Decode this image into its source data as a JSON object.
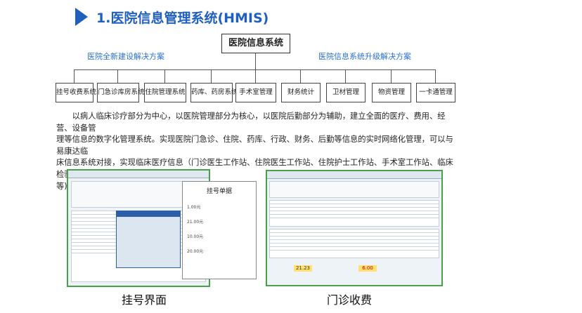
{
  "title": "1.医院信息管理系统(HMIS)",
  "root": "医院信息系统",
  "branches": {
    "left": "医院全新建设解决方案",
    "right": "医院信息系统升级解决方案"
  },
  "modules": [
    "挂号收费系统",
    "门急诊库房系统",
    "住院管理系统",
    "药库、药房系统",
    "手术室管理",
    "财务统计",
    "卫材管理",
    "物资管理",
    "一卡通管理"
  ],
  "paragraph": "以病人临床诊疗部分为中心，以医院管理部分为核心，以医院后勤部分为辅助，建立全面的医疗、费用、经营、设备管理等信息的数字化管理系统。实现医院门急诊、住院、药库、行政、财务、后勤等信息的实时网络化管理，可以与易康达临床信息系统对接，实现临床医疗信息（门诊医生工作站、住院医生工作站、住院护士工作站、手术室工作站、临床检验系统等)的全面动态的数字化管理。",
  "paragraph_lines": [
    "　　以病人临床诊疗部分为中心，以医院管理部分为核心，以医院后勤部分为辅助，建立全面的医疗、费用、经营、设备管",
    "理等信息的数字化管理系统。实现医院门急诊、住院、药库、行政、财务、后勤等信息的实时网络化管理，可以与易康达临",
    "床信息系统对接，实现临床医疗信息（门诊医生工作站、住院医生工作站、住院护士工作站、手术室工作站、临床检验系统",
    "等)的全面动态的数字化管理。"
  ],
  "screenshots": [
    {
      "caption": "挂号界面",
      "ticket": {
        "title": "挂号单据",
        "amount_1": "1.00元",
        "amount_2": "21.00元",
        "amount_3": "10.00元",
        "amount_4": "20.00元"
      }
    },
    {
      "caption": "门诊收费",
      "total_1": "21.23",
      "total_2": "6.00"
    }
  ],
  "colors": {
    "accent": "#1f5fbf",
    "branch_label": "#2a6fd6",
    "screenshot_border": "#4aa04a",
    "amount_yellow": "#ffe070"
  }
}
